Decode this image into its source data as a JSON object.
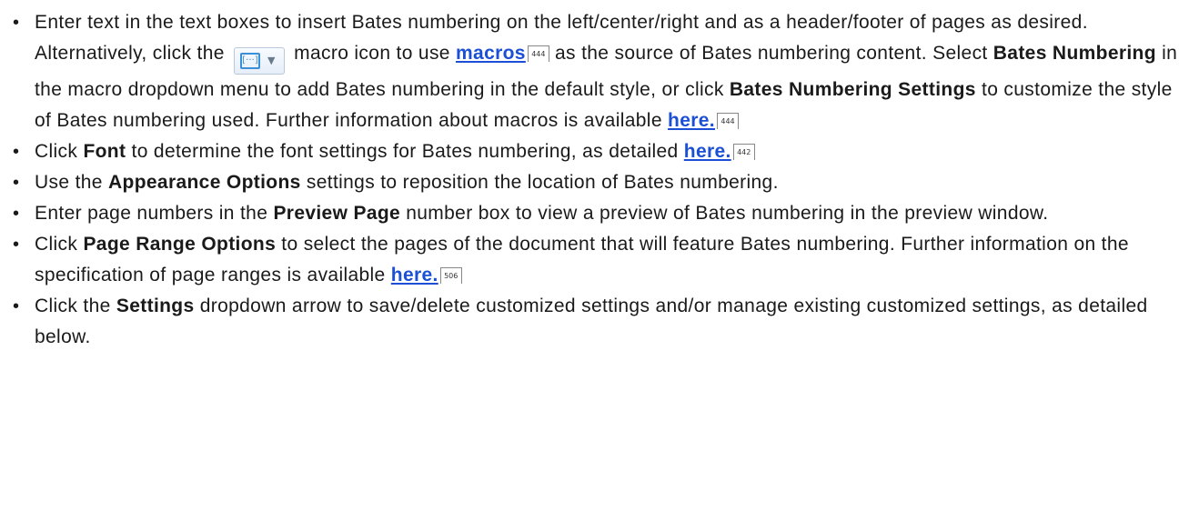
{
  "items": [
    {
      "p1": "Enter text in the text boxes to insert Bates numbering on the left/center/right and as a header/footer of pages as desired. Alternatively, click the",
      "macro_icon": {
        "name": "macro-icon",
        "glyph": "[···]",
        "caret": "▼"
      },
      "p2": "macro icon to use",
      "link1": "macros",
      "ref1": "444",
      "p3": "as the source of Bates numbering content. Select",
      "b1": "Bates Numbering",
      "p4": "in the macro dropdown menu to add Bates numbering in the default style, or click",
      "b2": "Bates Numbering Settings",
      "p5": "to customize the style of Bates numbering used. Further information about macros is available",
      "link2": "here.",
      "ref2": "444"
    },
    {
      "p1": "Click",
      "b1": "Font",
      "p2": "to determine the font settings for Bates numbering, as detailed",
      "link1": "here.",
      "ref1": "442"
    },
    {
      "p1": "Use the",
      "b1": "Appearance Options",
      "p2": "settings to reposition the location of Bates numbering."
    },
    {
      "p1": "Enter page numbers in the",
      "b1": "Preview Page",
      "p2": "number box to view a preview of Bates numbering in the preview window."
    },
    {
      "p1": "Click",
      "b1": "Page Range Options",
      "p2": "to select the pages of the document that will feature Bates numbering. Further information on the specification of page ranges is available",
      "link1": "here.",
      "ref1": "506"
    },
    {
      "p1": "Click the",
      "b1": "Settings",
      "p2": "dropdown arrow to save/delete customized settings and/or manage existing customized settings, as detailed below."
    }
  ],
  "bullet_char": "•",
  "colors": {
    "text": "#1a1a1a",
    "link": "#1a4fd6",
    "icon_accent": "#3b8fd9"
  }
}
